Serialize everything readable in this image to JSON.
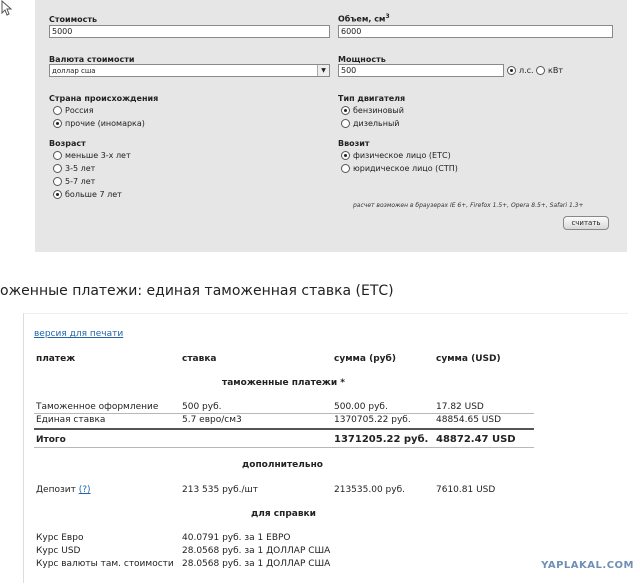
{
  "form": {
    "cost_label": "Стоимость",
    "cost_value": "5000",
    "volume_label": "Объем, см",
    "volume_sup": "3",
    "volume_value": "6000",
    "currency_label": "Валюта стоимости",
    "currency_value": "доллар сша",
    "power_label": "Мощность",
    "power_value": "500",
    "power_units": [
      {
        "label": "л.с.",
        "selected": true
      },
      {
        "label": "кВт",
        "selected": false
      }
    ],
    "origin_label": "Страна происхождения",
    "origin_options": [
      {
        "label": "Россия",
        "selected": false
      },
      {
        "label": "прочие (иномарка)",
        "selected": true
      }
    ],
    "engine_label": "Тип двигателя",
    "engine_options": [
      {
        "label": "бензиновый",
        "selected": true
      },
      {
        "label": "дизельный",
        "selected": false
      }
    ],
    "age_label": "Возраст",
    "age_options": [
      {
        "label": "меньше 3-х лет",
        "selected": false
      },
      {
        "label": "3-5 лет",
        "selected": false
      },
      {
        "label": "5-7 лет",
        "selected": false
      },
      {
        "label": "больше 7 лет",
        "selected": true
      }
    ],
    "importer_label": "Ввозит",
    "importer_options": [
      {
        "label": "физическое лицо (ЕТС)",
        "selected": true
      },
      {
        "label": "юридическое лицо (СТП)",
        "selected": false
      }
    ],
    "browser_note": "расчет возможен в браузерах IE 6+, Firefox 1.5+, Opera 8.5+, Safari 1.3+",
    "submit_label": "считать"
  },
  "results_heading": "оженные платежи: единая таможенная ставка (ЕТС)",
  "results": {
    "print_link": "версия для печати",
    "columns": [
      "платеж",
      "ставка",
      "сумма (руб)",
      "сумма (USD)"
    ],
    "section_customs": "таможенные платежи *",
    "customs_rows": [
      [
        "Таможенное оформление",
        "500 руб.",
        "500.00 руб.",
        "17.82 USD"
      ],
      [
        "Единая ставка",
        "5.7 евро/см3",
        "1370705.22 руб.",
        "48854.65 USD"
      ]
    ],
    "total": [
      "Итого",
      "",
      "1371205.22 руб.",
      "48872.47 USD"
    ],
    "section_additional": "дополнительно",
    "deposit": {
      "label": "Депозит",
      "help": "(?)",
      "rate": "213 535 руб./шт",
      "rub": "213535.00 руб.",
      "usd": "7610.81 USD"
    },
    "section_reference": "для справки",
    "reference_rows": [
      [
        "Курс Евро",
        "40.0791 руб. за 1 ЕВРО"
      ],
      [
        "Курс USD",
        "28.0568 руб. за 1 ДОЛЛАР США"
      ],
      [
        "Курс валюты там. стоимости",
        "28.0568 руб. за 1 ДОЛЛАР США"
      ]
    ]
  },
  "watermark": "YAPLAKAL.COM"
}
